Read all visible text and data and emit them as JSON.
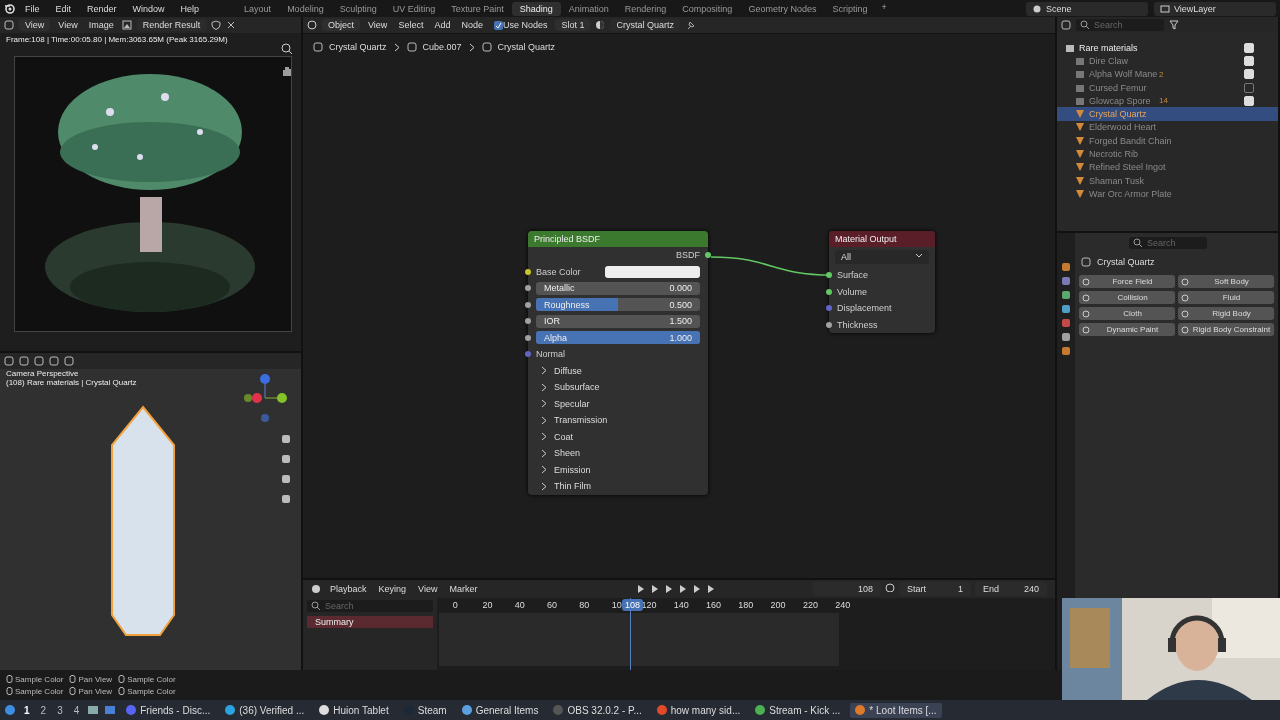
{
  "menu": [
    "File",
    "Edit",
    "Render",
    "Window",
    "Help"
  ],
  "workspaces": [
    {
      "label": "Layout",
      "selected": false
    },
    {
      "label": "Modeling",
      "selected": false
    },
    {
      "label": "Sculpting",
      "selected": false
    },
    {
      "label": "UV Editing",
      "selected": false
    },
    {
      "label": "Texture Paint",
      "selected": false
    },
    {
      "label": "Shading",
      "selected": true
    },
    {
      "label": "Animation",
      "selected": false
    },
    {
      "label": "Rendering",
      "selected": false
    },
    {
      "label": "Compositing",
      "selected": false
    },
    {
      "label": "Geometry Nodes",
      "selected": false
    },
    {
      "label": "Scripting",
      "selected": false
    }
  ],
  "add_workspace": "+",
  "scene": "Scene",
  "view_layer": "ViewLayer",
  "image_editor": {
    "view_menu": "View",
    "menus": [
      "View",
      "Image"
    ],
    "image_name": "Render Result",
    "info": "Frame:108 | Time:00:05.80 | Mem:3063.65M (Peak 3165.29M)"
  },
  "viewport": {
    "camera": "Camera Perspective",
    "object": "(108) Rare materials | Crystal Quartz"
  },
  "node_editor": {
    "mode": "Object",
    "menus": [
      "View",
      "Select",
      "Add",
      "Node"
    ],
    "use_nodes": {
      "label": "Use Nodes",
      "checked": true
    },
    "slot": "Slot 1",
    "material": "Crystal Quartz",
    "breadcrumbs": [
      "Crystal Quartz",
      "Cube.007",
      "Crystal Quartz"
    ],
    "principled": {
      "title": "Principled BSDF",
      "output": "BSDF",
      "inputs": [
        {
          "kind": "color",
          "label": "Base Color",
          "color": "#c7c729"
        },
        {
          "kind": "slider",
          "label": "Metallic",
          "value": "0.000",
          "level": 0,
          "color": "#a1a1a1"
        },
        {
          "kind": "slider",
          "label": "Roughness",
          "value": "0.500",
          "level": 0.5,
          "color": "#a1a1a1"
        },
        {
          "kind": "slider",
          "label": "IOR",
          "value": "1.500",
          "level": 0,
          "color": "#a1a1a1"
        },
        {
          "kind": "slider",
          "label": "Alpha",
          "value": "1.000",
          "level": 1,
          "color": "#a1a1a1"
        },
        {
          "kind": "socket",
          "label": "Normal",
          "color": "#6363c7"
        },
        {
          "kind": "panel",
          "label": "Diffuse"
        },
        {
          "kind": "panel",
          "label": "Subsurface"
        },
        {
          "kind": "panel",
          "label": "Specular"
        },
        {
          "kind": "panel",
          "label": "Transmission"
        },
        {
          "kind": "panel",
          "label": "Coat"
        },
        {
          "kind": "panel",
          "label": "Sheen"
        },
        {
          "kind": "panel",
          "label": "Emission"
        },
        {
          "kind": "panel",
          "label": "Thin Film"
        }
      ]
    },
    "output": {
      "title": "Material Output",
      "target": "All",
      "inputs": [
        {
          "label": "Surface",
          "color": "#63c763"
        },
        {
          "label": "Volume",
          "color": "#63c763"
        },
        {
          "label": "Displacement",
          "color": "#6363c7"
        },
        {
          "label": "Thickness",
          "color": "#a1a1a1"
        }
      ]
    }
  },
  "timeline": {
    "menus": [
      "Playback",
      "Keying",
      "View",
      "Marker"
    ],
    "current_frame": "108",
    "start_label": "Start",
    "start": "1",
    "end_label": "End",
    "end": "240",
    "search_placeholder": "Search",
    "ticks": [
      "0",
      "20",
      "40",
      "60",
      "80",
      "10",
      "120",
      "140",
      "160",
      "180",
      "200",
      "220",
      "240"
    ],
    "marker": "108",
    "channel": "Summary"
  },
  "outliner": {
    "search_placeholder": "Search",
    "collection": {
      "name": "Rare materials",
      "checked": true
    },
    "items": [
      {
        "kind": "collection",
        "name": "Dire Claw",
        "checked": true,
        "selected": false
      },
      {
        "kind": "collection",
        "name": "Alpha Wolf Mane",
        "badge": "2",
        "checked": true,
        "selected": false
      },
      {
        "kind": "collection",
        "name": "Cursed Femur",
        "checked": false,
        "selected": false
      },
      {
        "kind": "collection",
        "name": "Glowcap Spore",
        "badge": "14",
        "checked": true,
        "selected": false
      },
      {
        "kind": "object",
        "name": "Crystal Quartz",
        "selected": true
      },
      {
        "kind": "object",
        "name": "Elderwood Heart",
        "selected": false
      },
      {
        "kind": "object",
        "name": "Forged Bandit Chain",
        "selected": false
      },
      {
        "kind": "object",
        "name": "Necrotic Rib",
        "selected": false
      },
      {
        "kind": "object",
        "name": "Refined Steel Ingot",
        "selected": false
      },
      {
        "kind": "object",
        "name": "Shaman Tusk",
        "selected": false
      },
      {
        "kind": "object",
        "name": "War Orc Armor Plate",
        "selected": false
      }
    ]
  },
  "properties": {
    "search_placeholder": "Search",
    "object": "Crystal Quartz",
    "physics": [
      "Force Field",
      "Soft Body",
      "Collision",
      "Fluid",
      "Cloth",
      "Rigid Body",
      "Dynamic Paint",
      "Rigid Body Constraint"
    ]
  },
  "status_bar": [
    [
      "Sample Color",
      "Pan View",
      "Sample Color"
    ],
    [
      "Sample Color",
      "Pan View",
      "Sample Color"
    ]
  ],
  "taskbar": {
    "desktops": [
      {
        "label": "1",
        "selected": true
      },
      {
        "label": "2",
        "selected": false
      },
      {
        "label": "3",
        "selected": false
      },
      {
        "label": "4",
        "selected": false
      }
    ],
    "apps": [
      {
        "label": "Friends - Disc...",
        "selected": false
      },
      {
        "label": "(36) Verified ...",
        "selected": false
      },
      {
        "label": "Huion Tablet",
        "selected": false
      },
      {
        "label": "Steam",
        "selected": false
      },
      {
        "label": "General Items",
        "selected": false
      },
      {
        "label": "OBS 32.0.2 - P...",
        "selected": false
      },
      {
        "label": "how many sid...",
        "selected": false
      },
      {
        "label": "Stream - Kick ...",
        "selected": false
      },
      {
        "label": "* Loot Items [...",
        "selected": true
      }
    ]
  }
}
